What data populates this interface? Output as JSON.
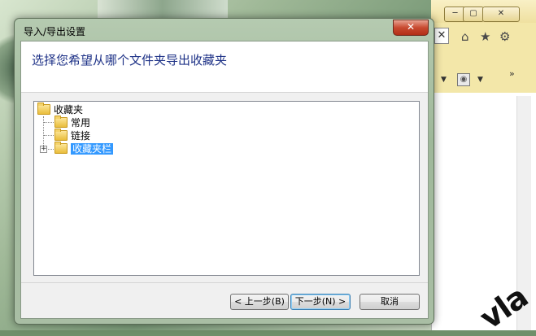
{
  "dialog": {
    "title": "导入/导出设置",
    "close_label": "✕",
    "header": "选择您希望从哪个文件夹导出收藏夹",
    "tree": {
      "root": "收藏夹",
      "children": [
        {
          "label": "常用",
          "expandable": false
        },
        {
          "label": "链接",
          "expandable": false
        },
        {
          "label": "收藏夹栏",
          "expandable": true,
          "selected": true
        }
      ]
    },
    "buttons": {
      "back": "< 上一步(B)",
      "next": "下一步(N) >",
      "cancel": "取消"
    }
  },
  "browser": {
    "window_buttons": {
      "minimize": "─",
      "maximize": "▢",
      "close": "✕"
    },
    "toolbar_close": "✕",
    "icons": [
      "home-icon",
      "star-icon",
      "gear-icon",
      "rss-icon"
    ],
    "chevron": "»"
  },
  "watermark": "vla"
}
